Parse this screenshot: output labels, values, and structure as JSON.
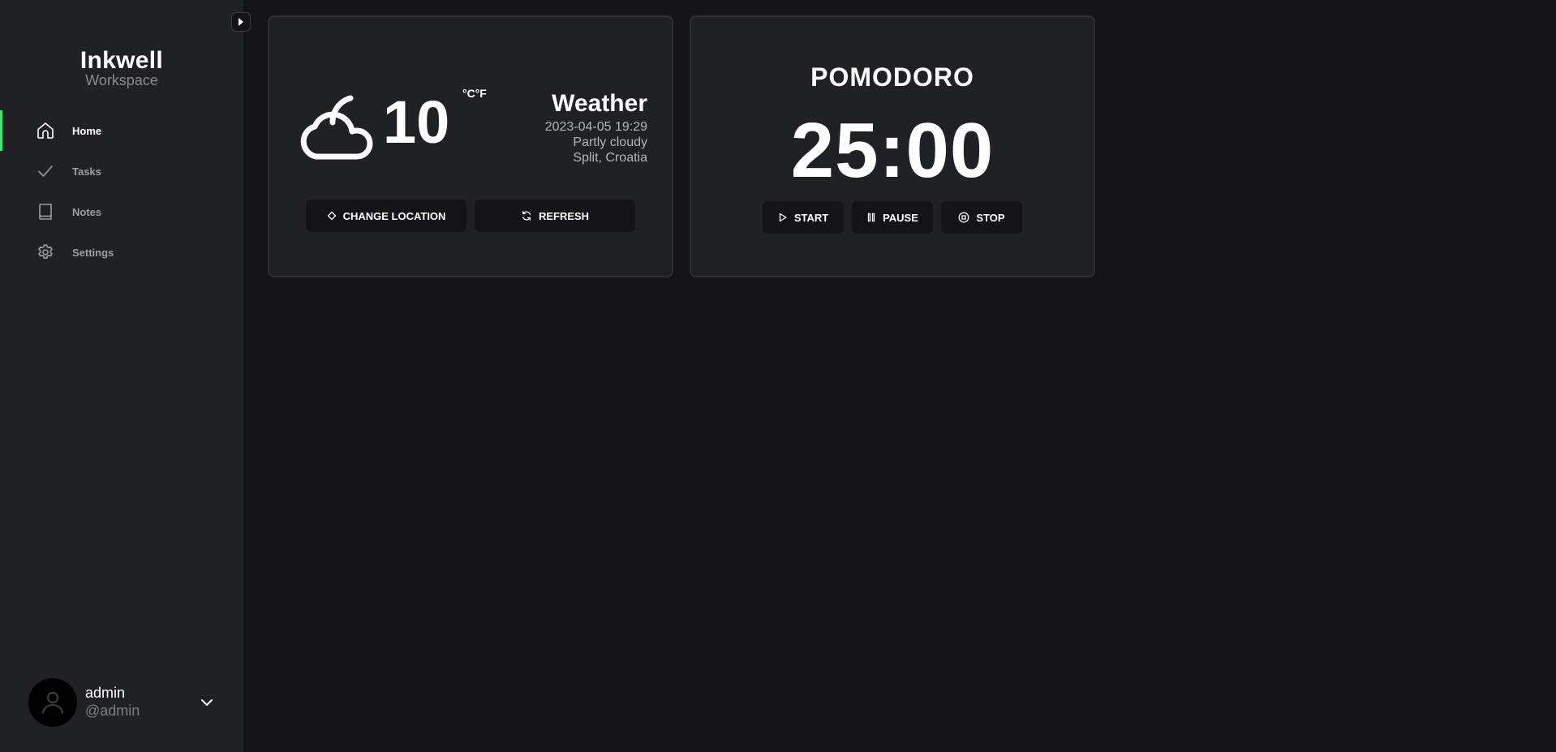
{
  "brand": {
    "name": "Inkwell",
    "subtitle": "Workspace"
  },
  "nav": {
    "items": [
      {
        "label": "Home",
        "icon": "home-icon",
        "active": true
      },
      {
        "label": "Tasks",
        "icon": "check-icon",
        "active": false
      },
      {
        "label": "Notes",
        "icon": "book-icon",
        "active": false
      },
      {
        "label": "Settings",
        "icon": "gear-icon",
        "active": false
      }
    ]
  },
  "user": {
    "name": "admin",
    "handle": "@admin"
  },
  "weather": {
    "temperature": "10",
    "units": "°C°F",
    "title": "Weather",
    "datetime": "2023-04-05 19:29",
    "condition": "Partly cloudy",
    "location": "Split, Croatia",
    "change_location_label": "CHANGE LOCATION",
    "refresh_label": "REFRESH"
  },
  "pomodoro": {
    "title": "POMODORO",
    "time": "25:00",
    "start_label": "START",
    "pause_label": "PAUSE",
    "stop_label": "STOP"
  },
  "colors": {
    "accent": "#4ade80",
    "background": "#141416",
    "panel": "#202124"
  }
}
